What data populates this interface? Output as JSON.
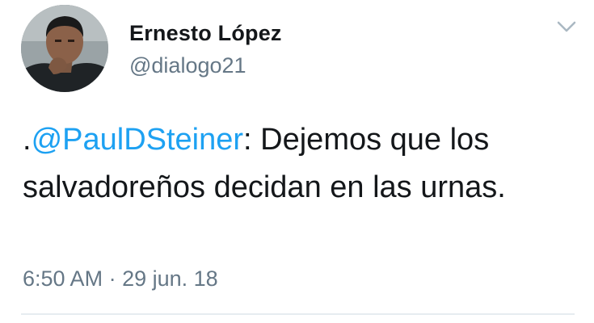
{
  "author": {
    "name": "Ernesto López",
    "handle": "@dialogo21"
  },
  "tweet": {
    "prefix": ".",
    "mention": "@PaulDSteiner",
    "text_after_mention": ": Dejemos que los salvadoreños decidan en las urnas."
  },
  "meta": {
    "time": "6:50 AM",
    "separator": " · ",
    "date": "29 jun. 18"
  },
  "colors": {
    "link": "#1da1f2",
    "secondary_text": "#657786",
    "primary_text": "#14171a",
    "divider": "#e6ecf0"
  },
  "icons": {
    "menu": "chevron-down-icon"
  }
}
